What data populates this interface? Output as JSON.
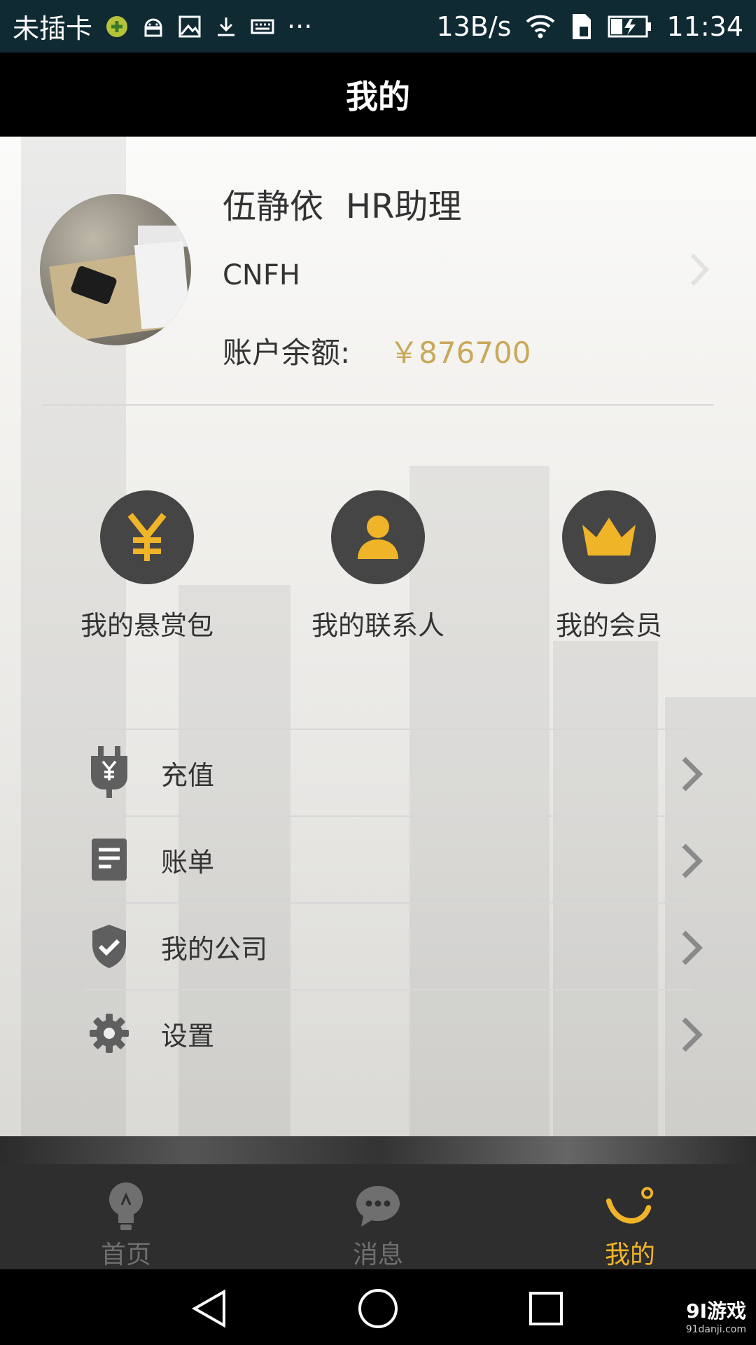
{
  "status_bar": {
    "carrier": "未插卡",
    "more": "···",
    "speed": "13B/s",
    "time": "11:34",
    "icons": [
      "app-plus-icon",
      "android-icon",
      "image-icon",
      "download-icon",
      "keyboard-icon",
      "wifi-icon",
      "sim-icon",
      "battery-charging-icon"
    ]
  },
  "appbar": {
    "title": "我的"
  },
  "profile": {
    "name": "伍静依",
    "position": "HR助理",
    "company": "CNFH",
    "balance_label": "账户余额:",
    "balance_value": "￥876700"
  },
  "quick_actions": [
    {
      "label": "我的悬赏包",
      "icon": "yen-icon"
    },
    {
      "label": "我的联系人",
      "icon": "person-icon"
    },
    {
      "label": "我的会员",
      "icon": "crown-icon"
    }
  ],
  "menu": [
    {
      "label": "充值",
      "icon": "plug-yen-icon"
    },
    {
      "label": "账单",
      "icon": "document-icon"
    },
    {
      "label": "我的公司",
      "icon": "shield-check-icon"
    },
    {
      "label": "设置",
      "icon": "gear-icon"
    }
  ],
  "bottom_nav": [
    {
      "label": "首页",
      "icon": "bulb-icon",
      "active": false
    },
    {
      "label": "消息",
      "icon": "chat-icon",
      "active": false
    },
    {
      "label": "我的",
      "icon": "smile-icon",
      "active": true
    }
  ],
  "watermark": {
    "main": "9Ⅰ游戏",
    "sub": "91danji.com"
  },
  "colors": {
    "accent": "#f0b429",
    "balance": "#c9a85a",
    "icon_circle": "#454545"
  }
}
